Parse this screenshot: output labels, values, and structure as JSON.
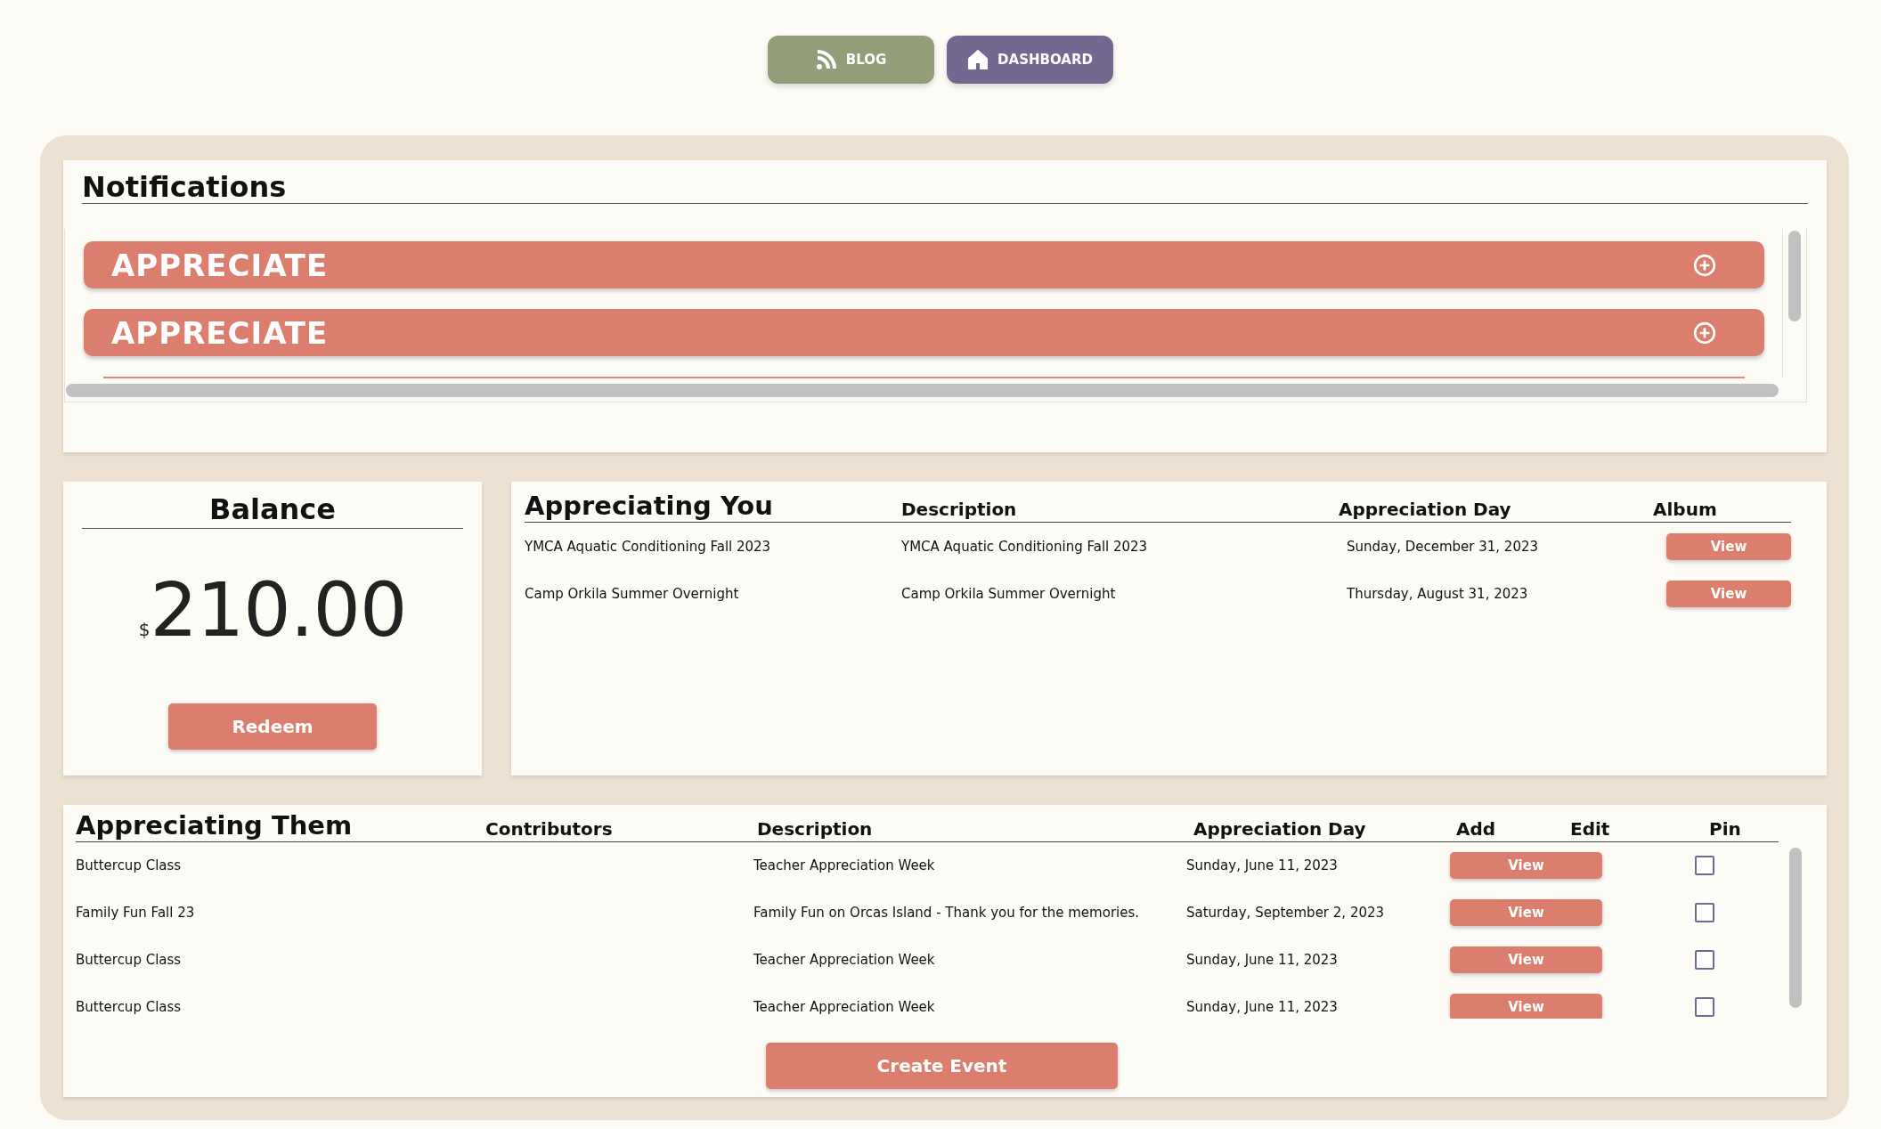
{
  "nav": [
    {
      "label": "BLOG"
    },
    {
      "label": "DASHBOARD"
    }
  ],
  "notifications": {
    "title": "Notifications",
    "items": [
      {
        "label": "APPRECIATE",
        "expanded": false
      },
      {
        "label": "APPRECIATE",
        "expanded": false
      }
    ]
  },
  "balance": {
    "title": "Balance",
    "currency": "$",
    "amount": "210.00",
    "button": "Redeem"
  },
  "appreciating_you": {
    "columns": [
      "Appreciating You",
      "Description",
      "Appreciation Day",
      "Album"
    ],
    "rows": [
      {
        "name": "YMCA Aquatic Conditioning Fall 2023",
        "description": "YMCA Aquatic Conditioning Fall 2023",
        "day": "Sunday, December 31, 2023",
        "album": "View"
      },
      {
        "name": "Camp Orkila Summer Overnight",
        "description": "Camp Orkila Summer Overnight",
        "day": "Thursday, August 31, 2023",
        "album": "View"
      }
    ]
  },
  "appreciating_them": {
    "columns": [
      "Appreciating Them",
      "Contributors",
      "Description",
      "Appreciation Day",
      "Add",
      "Edit",
      "Pin"
    ],
    "rows": [
      {
        "name": "Buttercup Class",
        "description": "Teacher Appreciation Week",
        "day": "Sunday, June 11, 2023",
        "add": "View",
        "pinned": false
      },
      {
        "name": "Family Fun Fall 23",
        "description": "Family Fun on Orcas Island - Thank you for the memories.",
        "day": "Saturday, September 2, 2023",
        "add": "View",
        "pinned": false
      },
      {
        "name": "Buttercup Class",
        "description": "Teacher Appreciation Week",
        "day": "Sunday, June 11, 2023",
        "add": "View",
        "pinned": false
      },
      {
        "name": "Buttercup Class",
        "description": "Teacher Appreciation Week",
        "day": "Sunday, June 11, 2023",
        "add": "View",
        "pinned": false
      }
    ],
    "button": "Create Event"
  }
}
